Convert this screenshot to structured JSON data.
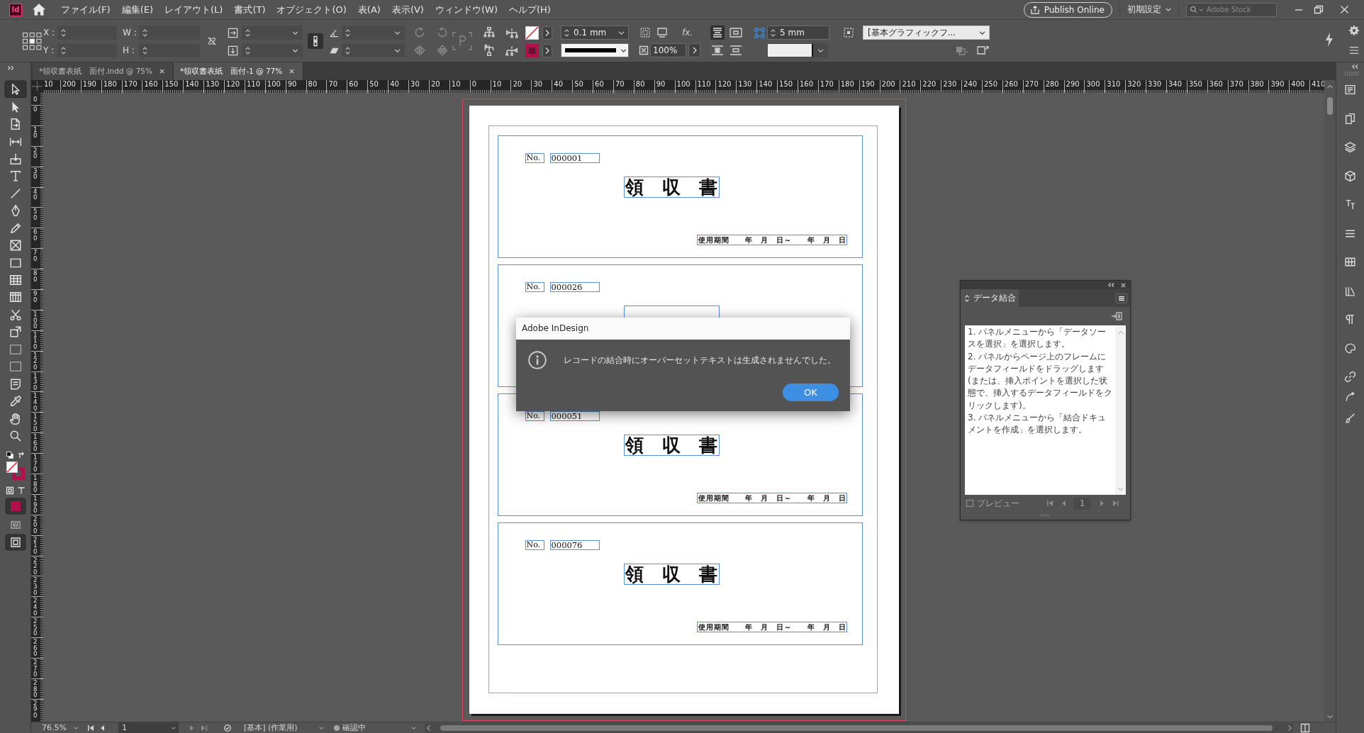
{
  "app": {
    "logo": "Id",
    "menu": [
      "ファイル(F)",
      "編集(E)",
      "レイアウト(L)",
      "書式(T)",
      "オブジェクト(O)",
      "表(A)",
      "表示(V)",
      "ウィンドウ(W)",
      "ヘルプ(H)"
    ],
    "publish_button": "Publish Online",
    "workspace": "初期設定",
    "search": {
      "placeholder": "Adobe Stock"
    }
  },
  "control_bar": {
    "x_label": "X :",
    "y_label": "Y :",
    "w_label": "W :",
    "h_label": "H :",
    "stroke_weight": "0.1 mm",
    "effects": "fx.",
    "scale": "100%",
    "frame_offset": "5 mm",
    "object_style": "[基本グラフィックフ..."
  },
  "tools": [
    {
      "kind": "selection",
      "selected": true
    },
    {
      "kind": "direct_selection",
      "selected": false
    },
    {
      "kind": "page",
      "selected": false
    },
    {
      "kind": "gap",
      "selected": false
    },
    {
      "kind": "collector",
      "selected": false
    },
    {
      "kind": "type",
      "selected": false
    },
    {
      "kind": "line",
      "selected": false
    },
    {
      "kind": "pen",
      "selected": false
    },
    {
      "kind": "pencil",
      "selected": false
    },
    {
      "kind": "frame",
      "selected": false
    },
    {
      "kind": "rectangle",
      "selected": false
    },
    {
      "kind": "table",
      "selected": false
    },
    {
      "kind": "columns",
      "selected": false
    },
    {
      "kind": "scissors",
      "selected": false
    },
    {
      "kind": "transform",
      "selected": false
    },
    {
      "kind": "gradient",
      "selected": false
    },
    {
      "kind": "feather",
      "selected": false
    },
    {
      "kind": "note",
      "selected": false
    },
    {
      "kind": "eyedropper",
      "selected": false
    },
    {
      "kind": "hand",
      "selected": false
    },
    {
      "kind": "zoom",
      "selected": false
    }
  ],
  "document_tabs": [
    {
      "label": "*領収書表紙　面付.indd @ 75%",
      "selected": false
    },
    {
      "label": "*領収書表紙　面付-1 @ 77%",
      "selected": true
    }
  ],
  "horizontal_ruler": [
    "10",
    "200",
    "190",
    "180",
    "170",
    "160",
    "150",
    "140",
    "130",
    "120",
    "110",
    "100",
    "90",
    "80",
    "70",
    "60",
    "50",
    "40",
    "30",
    "20",
    "10",
    "0",
    "10",
    "20",
    "30",
    "40",
    "50",
    "60",
    "70",
    "80",
    "90",
    "100",
    "110",
    "120",
    "130",
    "140",
    "150",
    "160",
    "170",
    "180",
    "190",
    "200",
    "210",
    "220",
    "230",
    "240",
    "250",
    "260",
    "270",
    "280",
    "290",
    "300",
    "310",
    "320",
    "330",
    "340",
    "350",
    "360",
    "370",
    "380",
    "390",
    "400",
    "410"
  ],
  "vertical_ruler": [
    "0",
    "0",
    "10",
    "20",
    "30",
    "40",
    "50",
    "60",
    "70",
    "80",
    "90",
    "100",
    "110",
    "120",
    "130",
    "140",
    "150",
    "160",
    "170",
    "180",
    "190",
    "200",
    "210",
    "220",
    "230",
    "240",
    "250",
    "260",
    "270",
    "280",
    "290"
  ],
  "page": {
    "receipts": [
      {
        "no_label": "No.",
        "number": "000001",
        "title": "領　収　書",
        "period": "使用期間　　年　月　日～　　年　月　日"
      },
      {
        "no_label": "No.",
        "number": "000026"
      },
      {
        "no_label": "No.",
        "number": "000051",
        "title": "領　収　書",
        "period": "使用期間　　年　月　日～　　年　月　日"
      },
      {
        "no_label": "No.",
        "number": "000076",
        "title": "領　収　書",
        "period": "使用期間　　年　月　日～　　年　月　日"
      }
    ]
  },
  "dialog": {
    "title": "Adobe InDesign",
    "message": "レコードの結合時にオーバーセットテキストは生成されませんでした。",
    "buttons": [
      "OK"
    ]
  },
  "data_merge_panel": {
    "title": "データ結合",
    "instructions": [
      "1. パネルメニューから「データソースを選択」を選択します。",
      "2. パネルからページ上のフレームにデータフィールドをドラッグします (または、挿入ポイントを選択した状態で、挿入するデータフィールドをクリックします)。",
      "3. パネルメニューから「結合ドキュメントを作成」を選択します。"
    ],
    "preview": {
      "label": "プレビュー",
      "checked": false,
      "disabled": true
    },
    "record": "1"
  },
  "status_bar": {
    "zoom": "76.5%",
    "page": "1",
    "profile": "[基本] (作業用)",
    "preflight": "確認中"
  }
}
